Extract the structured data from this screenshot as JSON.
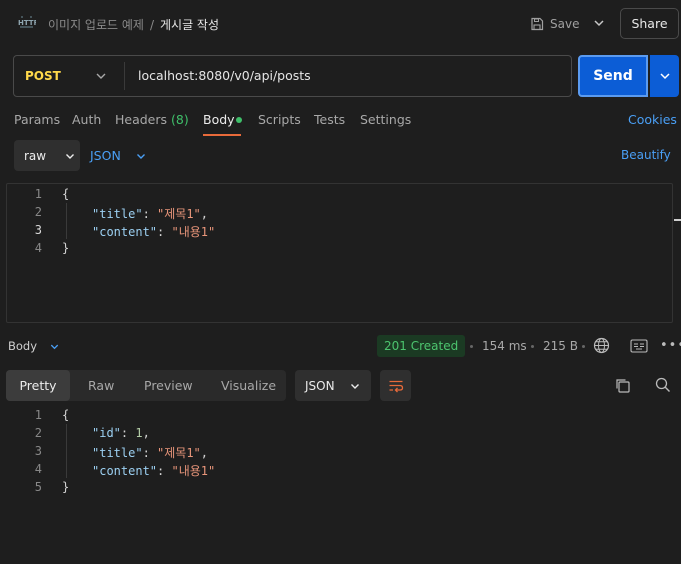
{
  "header": {
    "icon_text": "HTTP",
    "breadcrumb_parent": "이미지 업로드 예제",
    "breadcrumb_separator": "/",
    "breadcrumb_current": "게시글 작성",
    "save_label": "Save",
    "share_label": "Share"
  },
  "request": {
    "method": "POST",
    "url": "localhost:8080/v0/api/posts",
    "send_label": "Send",
    "tabs": [
      {
        "label": "Params"
      },
      {
        "label": "Auth"
      },
      {
        "label": "Headers",
        "count": "(8)"
      },
      {
        "label": "Body"
      },
      {
        "label": "Scripts"
      },
      {
        "label": "Tests"
      },
      {
        "label": "Settings"
      }
    ],
    "cookies_label": "Cookies",
    "body_mode": "raw",
    "body_format": "JSON",
    "beautify_label": "Beautify",
    "line_numbers": [
      "1",
      "2",
      "3",
      "4"
    ],
    "body_lines": {
      "l1": "{",
      "l2_key": "\"title\"",
      "l2_val": "\"제목1\"",
      "l3_key": "\"content\"",
      "l3_val": "\"내용1\"",
      "l4": "}"
    }
  },
  "response": {
    "label": "Body",
    "status": "201 Created",
    "time": "154 ms",
    "size": "215 B",
    "view_tabs": [
      "Pretty",
      "Raw",
      "Preview",
      "Visualize"
    ],
    "format": "JSON",
    "line_numbers": [
      "1",
      "2",
      "3",
      "4",
      "5"
    ],
    "body_lines": {
      "l1": "{",
      "l2_key": "\"id\"",
      "l2_val": "1",
      "l3_key": "\"title\"",
      "l3_val": "\"제목1\"",
      "l4_key": "\"content\"",
      "l4_val": "\"내용1\"",
      "l5": "}"
    }
  },
  "colors": {
    "accent_blue": "#0c5dd6",
    "method_yellow": "#ffd94a",
    "status_green": "#4cc46e",
    "active_tab_underline": "#e86a3a"
  },
  "icons": [
    "http-icon",
    "save-icon",
    "chevron-down-icon",
    "globe-icon",
    "save-response-icon",
    "more-icon",
    "wrap-icon",
    "copy-icon",
    "search-icon"
  ]
}
